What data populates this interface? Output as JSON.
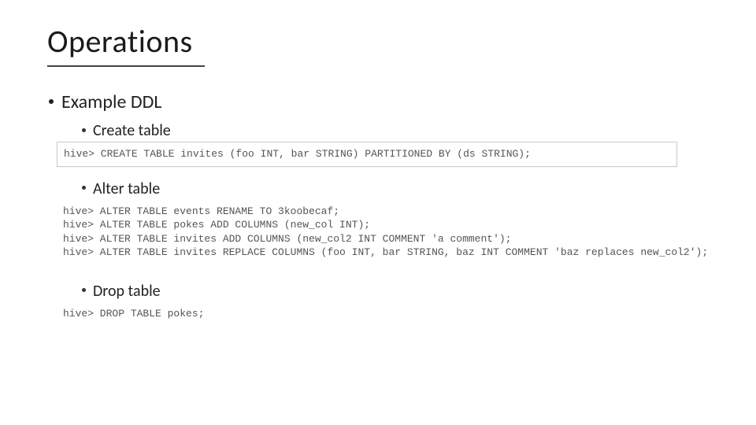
{
  "title": "Operations",
  "bullets": {
    "l1": "Example DDL",
    "create": "Create table",
    "alter": "Alter table",
    "drop": "Drop table"
  },
  "code": {
    "create": "hive> CREATE TABLE invites (foo INT, bar STRING) PARTITIONED BY (ds STRING);",
    "alter": "hive> ALTER TABLE events RENAME TO 3koobecaf;\nhive> ALTER TABLE pokes ADD COLUMNS (new_col INT);\nhive> ALTER TABLE invites ADD COLUMNS (new_col2 INT COMMENT 'a comment');\nhive> ALTER TABLE invites REPLACE COLUMNS (foo INT, bar STRING, baz INT COMMENT 'baz replaces new_col2');",
    "drop": "hive> DROP TABLE pokes;"
  }
}
